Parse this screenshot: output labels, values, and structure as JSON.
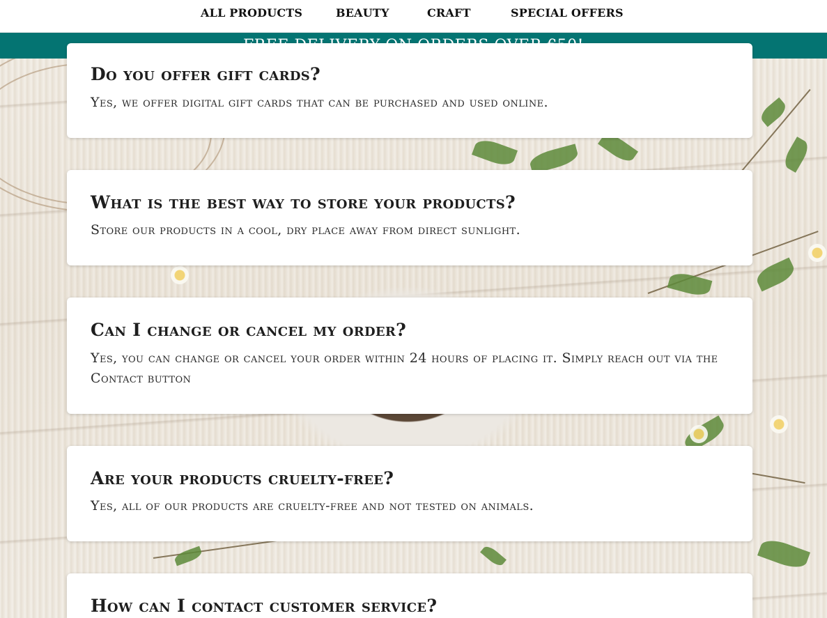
{
  "nav": {
    "items": [
      {
        "label": "ALL PRODUCTS"
      },
      {
        "label": "BEAUTY"
      },
      {
        "label": "CRAFT"
      },
      {
        "label": "SPECIAL OFFERS"
      }
    ]
  },
  "banner": {
    "text": "FREE DELIVERY ON ORDERS OVER €50!",
    "background_color": "#047472"
  },
  "faq": [
    {
      "question": "Do you offer gift cards?",
      "answer": "Yes, we offer digital gift cards that can be purchased and used online."
    },
    {
      "question": "What is the best way to store your products?",
      "answer": "Store our products in a cool, dry place away from direct sunlight."
    },
    {
      "question": "Can I change or cancel my order?",
      "answer": "Yes, you can change or cancel your order within 24 hours of placing it. Simply reach out via the Contact button"
    },
    {
      "question": "Are your products cruelty-free?",
      "answer": "Yes, all of our products are cruelty-free and not tested on animals."
    },
    {
      "question": "How can I contact customer service?",
      "answer": ""
    }
  ]
}
